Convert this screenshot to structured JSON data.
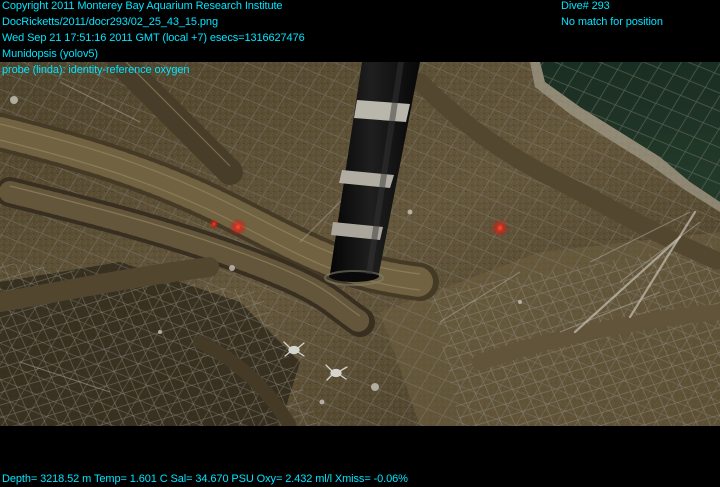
{
  "overlay": {
    "copyright": "Copyright 2011 Monterey Bay Aquarium Research Institute",
    "filepath": "DocRicketts/2011/docr293/02_25_43_15.png",
    "timestamp": "Wed Sep 21 17:51:16 2011 GMT (local +7)  esecs=1316627476",
    "species": "Munidopsis (yolov5)",
    "probe": "probe (linda): identity-reference oxygen",
    "dive": "Dive# 293",
    "position": "No match for position"
  },
  "telemetry": {
    "readout": "Depth= 3218.52 m  Temp= 1.601 C  Sal= 34.670 PSU  Oxy= 2.432 ml/l  Xmiss= -0.06%"
  },
  "colors": {
    "overlay_text": "#00e5ff",
    "laser": "#ff2a1a",
    "water": "#1f3a28",
    "sediment": "#6a5c40"
  }
}
